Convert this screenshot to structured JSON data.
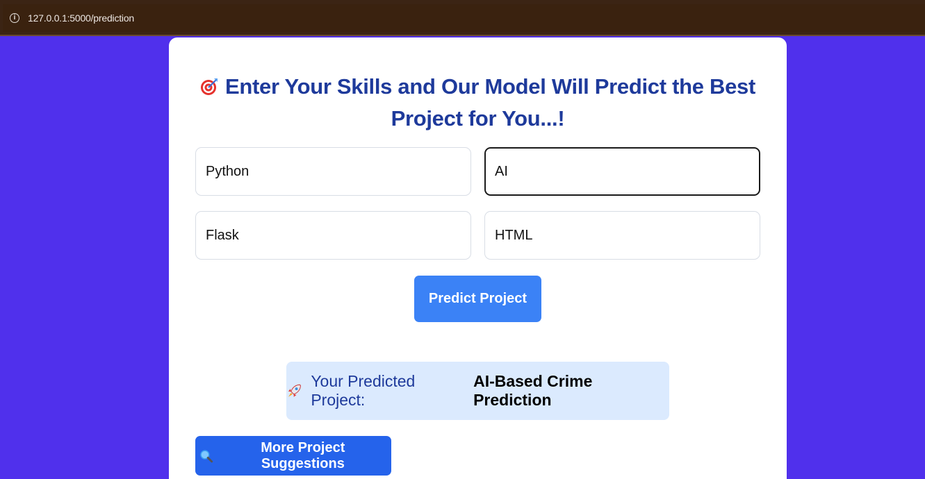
{
  "browser": {
    "url": "127.0.0.1:5000/prediction"
  },
  "page": {
    "title": "Enter Your Skills and Our Model Will Predict the Best Project for You...!",
    "title_icon": "target-icon"
  },
  "skills": [
    {
      "value": "Python",
      "focused": false
    },
    {
      "value": "AI",
      "focused": true
    },
    {
      "value": "Flask",
      "focused": false
    },
    {
      "value": "HTML",
      "focused": false
    }
  ],
  "predict_button": {
    "label": "Predict Project"
  },
  "result": {
    "icon": "rocket-icon",
    "label": "Your Predicted Project:",
    "value": "AI-Based Crime Prediction"
  },
  "more_button": {
    "icon": "magnifier-icon",
    "label": "More Project Suggestions"
  },
  "colors": {
    "background": "#5030ec",
    "title": "#1e3a9b",
    "predict_button": "#3b82f6",
    "more_button": "#2563eb",
    "result_background": "#dbeafe"
  }
}
